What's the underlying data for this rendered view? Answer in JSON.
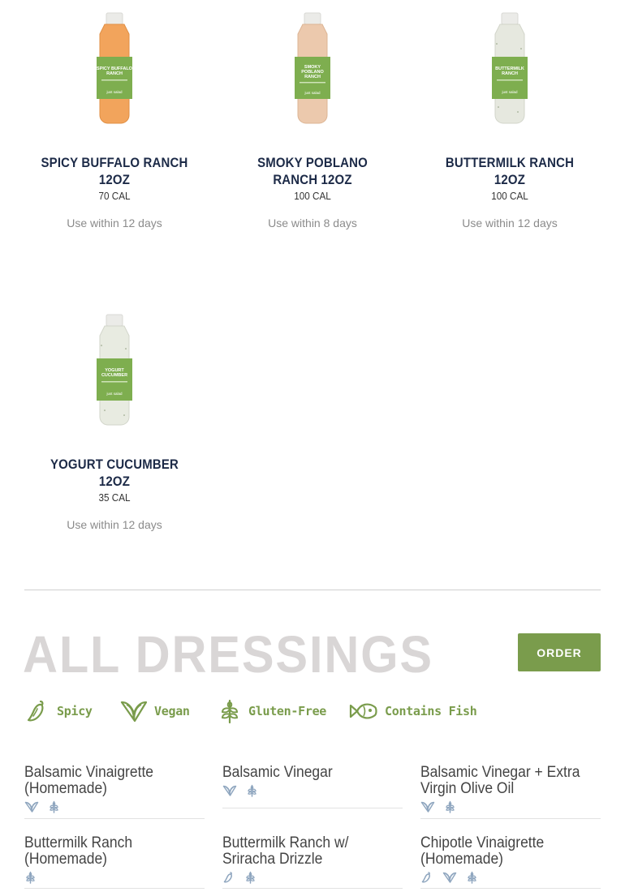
{
  "products": [
    {
      "name": "Spicy Buffalo Ranch 12oz",
      "name_line1": "SPICY BUFFALO RANCH",
      "name_line2": "12OZ",
      "calories": "70 CAL",
      "use_within": "Use within 12 days",
      "label_text": "SPICY BUFFALO RANCH",
      "bottle_color": "#f2a45c"
    },
    {
      "name": "Smoky Poblano Ranch 12oz",
      "name_line1": "SMOKY POBLANO",
      "name_line2": "RANCH 12OZ",
      "calories": "100 CAL",
      "use_within": "Use within 8 days",
      "label_text": "SMOKY POBLANO RANCH",
      "bottle_color": "#ecc9ad"
    },
    {
      "name": "Buttermilk Ranch 12oz",
      "name_line1": "BUTTERMILK RANCH",
      "name_line2": "12OZ",
      "calories": "100 CAL",
      "use_within": "Use within 12 days",
      "label_text": "BUTTERMILK RANCH",
      "bottle_color": "#e6e8df"
    },
    {
      "name": "Yogurt Cucumber 12oz",
      "name_line1": "YOGURT CUCUMBER",
      "name_line2": "12OZ",
      "calories": "35 CAL",
      "use_within": "Use within 12 days",
      "label_text": "YOGURT CUCUMBER",
      "bottle_color": "#e8ebe1"
    }
  ],
  "section": {
    "title": "ALL DRESSINGS",
    "order_label": "ORDER"
  },
  "legend": [
    {
      "icon": "pepper-icon",
      "label": "Spicy"
    },
    {
      "icon": "vegan-icon",
      "label": "Vegan"
    },
    {
      "icon": "wheat-icon",
      "label": "Gluten-Free"
    },
    {
      "icon": "fish-icon",
      "label": "Contains Fish"
    }
  ],
  "dressings": [
    {
      "line1": "Balsamic Vinaigrette",
      "line2": "(Homemade)",
      "icons": [
        "vegan-icon",
        "wheat-icon"
      ]
    },
    {
      "line1": "Balsamic Vinegar",
      "line2": "",
      "icons": [
        "vegan-icon",
        "wheat-icon"
      ]
    },
    {
      "line1": "Balsamic Vinegar + Extra",
      "line2": "Virgin Olive Oil",
      "icons": [
        "vegan-icon",
        "wheat-icon"
      ]
    },
    {
      "line1": "Buttermilk Ranch",
      "line2": "(Homemade)",
      "icons": [
        "wheat-icon"
      ]
    },
    {
      "line1": "Buttermilk Ranch w/",
      "line2": "Sriracha Drizzle",
      "icons": [
        "pepper-icon",
        "wheat-icon"
      ]
    },
    {
      "line1": "Chipotle Vinaigrette",
      "line2": "(Homemade)",
      "icons": [
        "pepper-icon",
        "vegan-icon",
        "wheat-icon"
      ]
    }
  ],
  "colors": {
    "accent_green": "#7a9c4c",
    "heading_gray": "#d9d6d6",
    "product_name_navy": "#1c2a47",
    "icon_blue": "#8fa6bf"
  }
}
